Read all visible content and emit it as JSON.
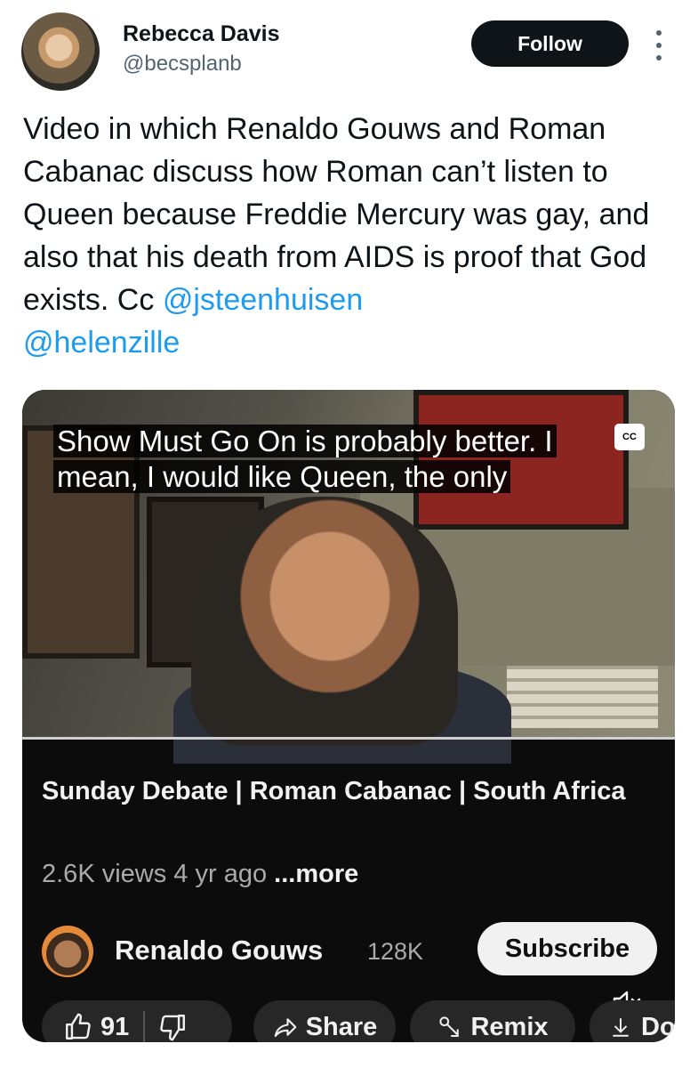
{
  "author": {
    "name": "Rebecca Davis",
    "handle": "@becsplanb",
    "follow_label": "Follow"
  },
  "tweet": {
    "text": "Video in which Renaldo Gouws and Roman Cabanac discuss how Roman can’t listen to Queen because Freddie Mercury was gay, and also that his death from AIDS is proof that God exists. Cc ",
    "mention1": "@jsteenhuisen",
    "mention2": "@helenzille"
  },
  "video": {
    "caption_line1": "Show Must Go On is probably better. I",
    "caption_line2": "mean, I would like Queen, the only",
    "cc_label": "CC",
    "title": "Sunday Debate | Roman Cabanac | South Africa",
    "views": "2.6K views",
    "age": "4 yr ago",
    "more_label": "...more",
    "channel_name": "Renaldo Gouws",
    "subscribers": "128K",
    "subscribe_label": "Subscribe",
    "like_count": "91",
    "share_label": "Share",
    "remix_label": "Remix",
    "download_label": "Do"
  },
  "icons": {
    "more": "more-dots-icon",
    "cc": "closed-captions-icon",
    "mute": "mute-icon",
    "like": "thumbs-up-icon",
    "dislike": "thumbs-down-icon",
    "share": "share-arrow-icon",
    "remix": "remix-icon",
    "download": "download-icon"
  }
}
